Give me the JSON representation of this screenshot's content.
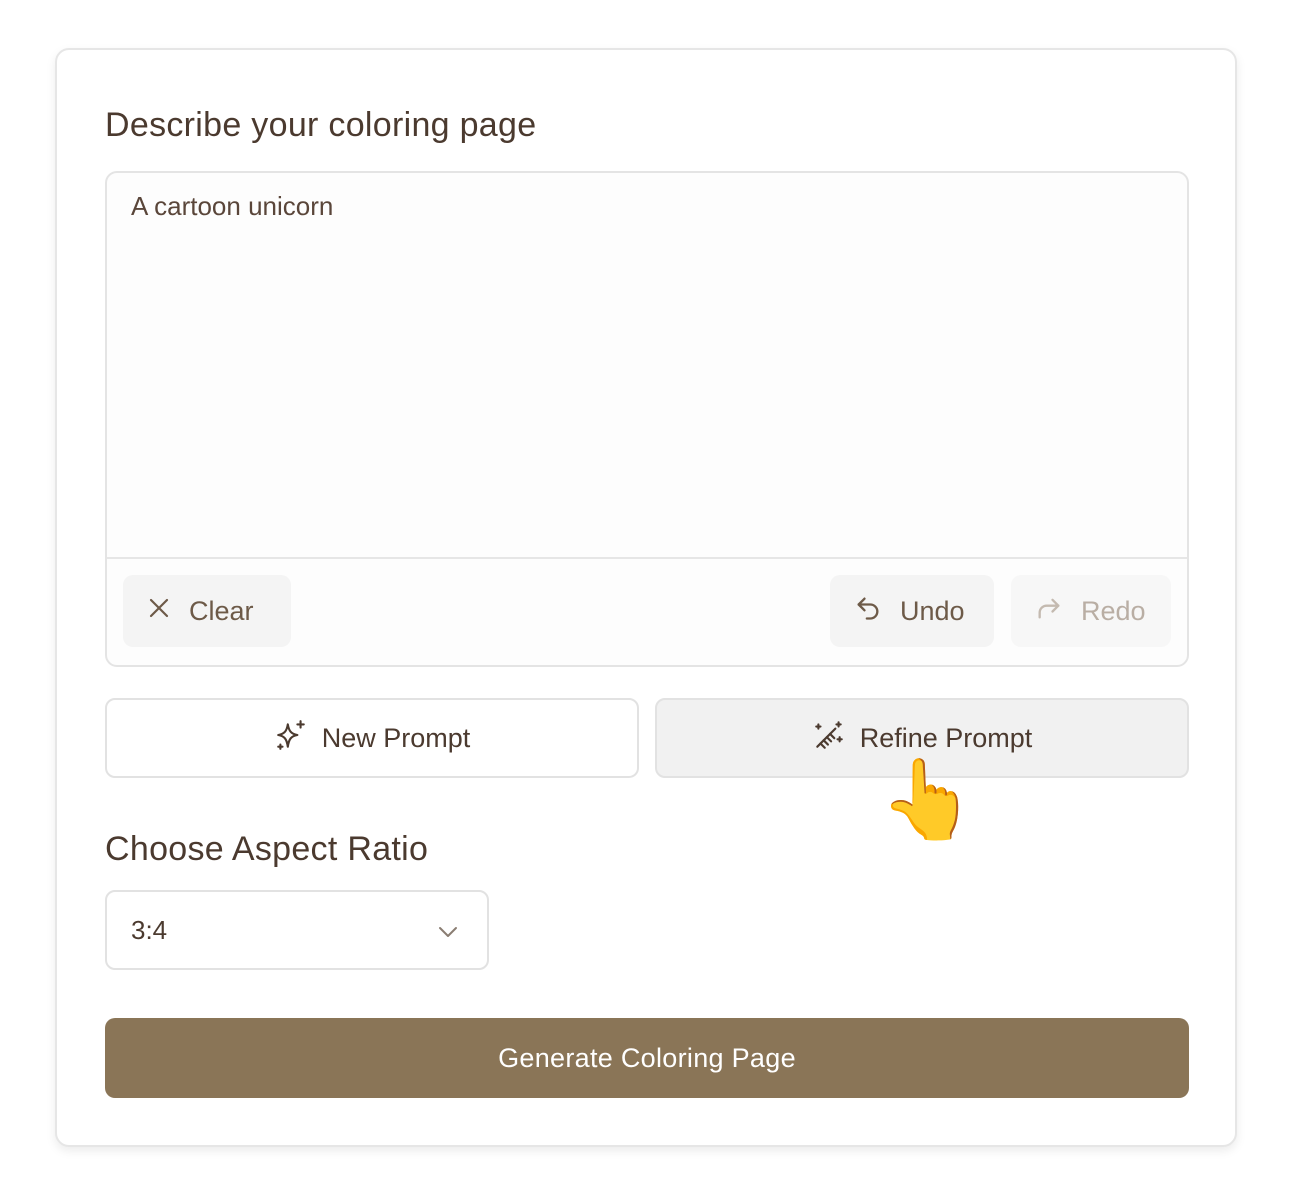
{
  "form": {
    "prompt_heading": "Describe your coloring page",
    "prompt_value": "A cartoon unicorn",
    "toolbar": {
      "clear_label": "Clear",
      "undo_label": "Undo",
      "redo_label": "Redo"
    },
    "new_prompt_label": "New Prompt",
    "refine_prompt_label": "Refine Prompt",
    "aspect_heading": "Choose Aspect Ratio",
    "aspect_value": "3:4",
    "generate_label": "Generate Coloring Page",
    "cursor_glyph": "👆"
  },
  "colors": {
    "accent": "#8a7557",
    "text": "#4b3a2f",
    "disabled_text": "#b9aea4"
  },
  "icons": {
    "clear": "x-icon",
    "undo": "undo-icon",
    "redo": "redo-icon",
    "new_prompt": "sparkles-icon",
    "refine_prompt": "magic-wand-icon",
    "select": "chevron-down-icon"
  }
}
